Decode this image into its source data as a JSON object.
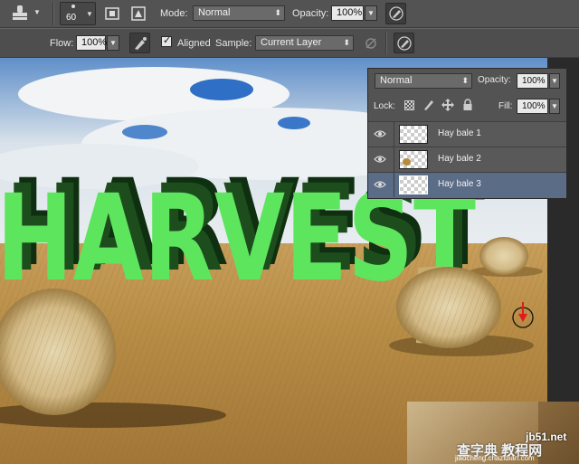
{
  "options_bar_top": {
    "brush_size": "60",
    "mode_label": "Mode:",
    "mode_value": "Normal",
    "opacity_label": "Opacity:",
    "opacity_value": "100%"
  },
  "options_bar_bottom": {
    "flow_label": "Flow:",
    "flow_value": "100%",
    "aligned_label": "Aligned",
    "aligned_checked": true,
    "sample_label": "Sample:",
    "sample_value": "Current Layer"
  },
  "canvas": {
    "headline_text": "HARVEST",
    "headline_color": "#5ee55e"
  },
  "layers_panel": {
    "blend_mode": "Normal",
    "opacity_label": "Opacity:",
    "opacity_value": "100%",
    "lock_label": "Lock:",
    "fill_label": "Fill:",
    "fill_value": "100%",
    "layers": [
      {
        "name": "Hay bale 1",
        "visible": true,
        "selected": false
      },
      {
        "name": "Hay bale 2",
        "visible": true,
        "selected": false
      },
      {
        "name": "Hay bale 3",
        "visible": true,
        "selected": true
      }
    ]
  },
  "watermark": {
    "site": "jb51.net",
    "line2": "查字典 教程网",
    "line3": "jiaocheng.chazidian.com"
  },
  "colors": {
    "selected_layer": "#5b6c86",
    "panel_bg": "#535353"
  }
}
